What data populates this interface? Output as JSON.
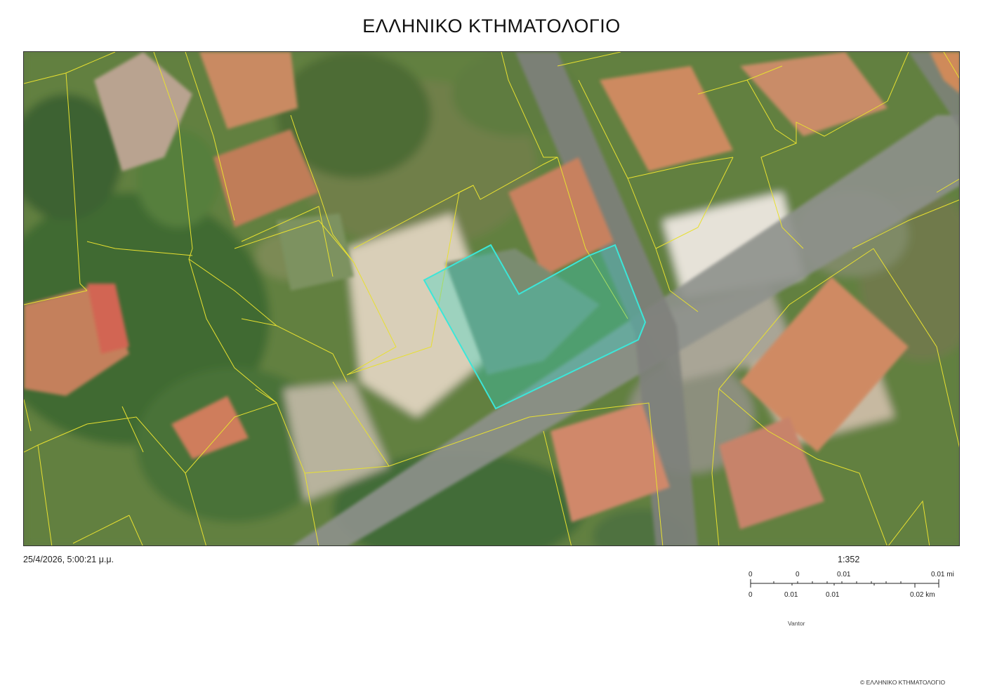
{
  "title": "ΕΛΛΗΝΙΚΟ ΚΤΗΜΑΤΟΛΟΓΙΟ",
  "print_datetime": "25/4/2026, 5:00:21 μ.μ.",
  "scale_ratio": "1:352",
  "scalebar": {
    "top_labels": [
      "0",
      "0",
      "0.01",
      "0.01 mi"
    ],
    "bottom_labels": [
      "0",
      "0.01",
      "0.01",
      "0.02 km"
    ]
  },
  "attribution": "Vantor",
  "copyright": "© ΕΛΛΗΝΙΚΟ ΚΤΗΜΑΤΟΛΟΓΙΟ",
  "map": {
    "basemap": "satellite imagery",
    "parcel_line_color": "#e8e030",
    "selected_parcel_color": "#3ce6d8",
    "road_color": "#8a8d88",
    "roof_color": "#c98a62"
  }
}
